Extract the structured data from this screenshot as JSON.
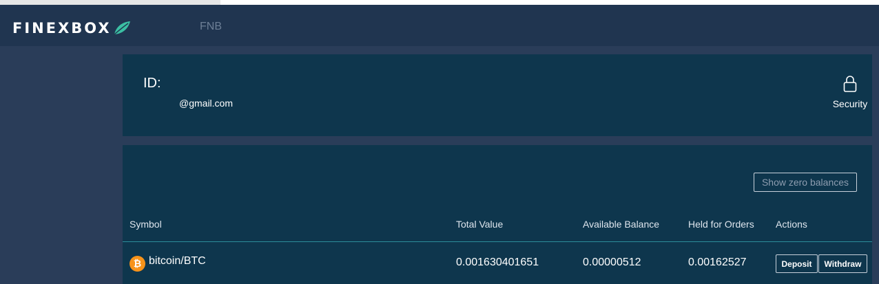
{
  "header": {
    "logo_text": "FINEXBOX",
    "nav_fnb": "FNB",
    "accent_color": "#3bbfa3"
  },
  "profile": {
    "id_label": "ID:",
    "email": "@gmail.com",
    "security_label": "Security"
  },
  "balances": {
    "show_zero_label": "Show zero balances",
    "columns": {
      "symbol": "Symbol",
      "total_value": "Total Value",
      "available_balance": "Available Balance",
      "held_for_orders": "Held for Orders",
      "actions": "Actions"
    },
    "rows": [
      {
        "icon": "bitcoin-icon",
        "icon_glyph": "₿",
        "icon_color": "#f7931a",
        "symbol": "bitcoin/BTC",
        "total_value": "0.001630401651",
        "available_balance": "0.00000512",
        "held_for_orders": "0.00162527",
        "deposit_label": "Deposit",
        "withdraw_label": "Withdraw"
      }
    ]
  }
}
